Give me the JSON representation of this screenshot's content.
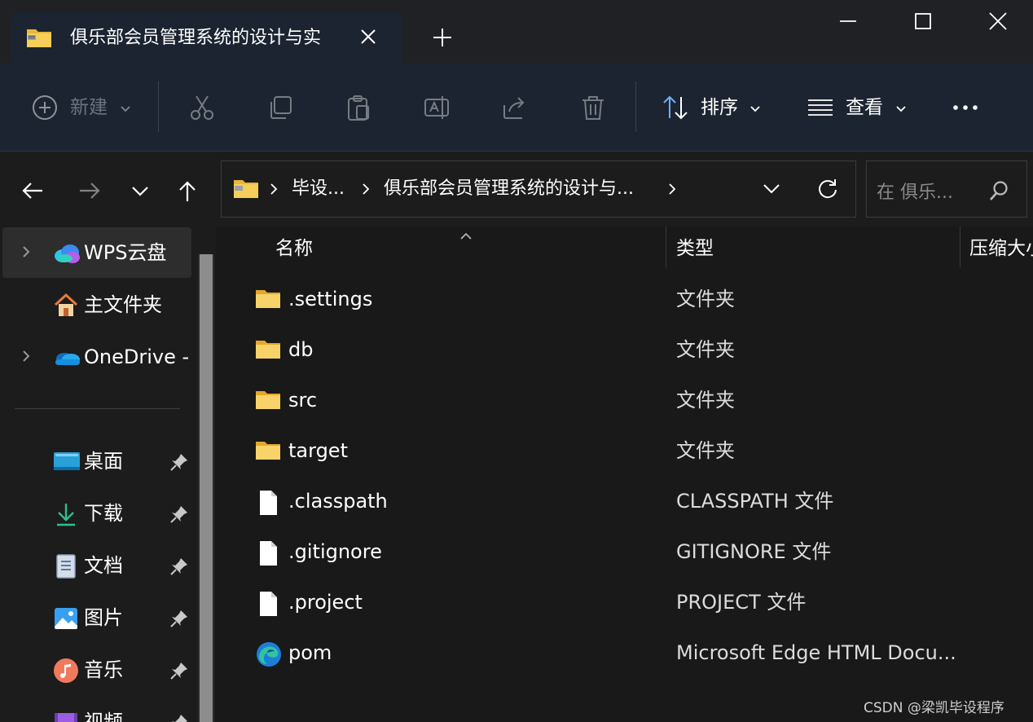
{
  "tab": {
    "title": "俱乐部会员管理系统的设计与实",
    "icon": "zip-folder-icon"
  },
  "window": {
    "minimize": "minimize-icon",
    "maximize": "maximize-icon",
    "close": "close-icon"
  },
  "command_bar": {
    "new_label": "新建",
    "sort_label": "排序",
    "view_label": "查看",
    "more": "more-icon"
  },
  "address": {
    "crumbs": [
      "毕设...",
      "俱乐部会员管理系统的设计与..."
    ]
  },
  "search": {
    "placeholder": "在 俱乐..."
  },
  "sidebar": {
    "items": [
      {
        "label": "WPS云盘",
        "icon": "wps-cloud-icon"
      },
      {
        "label": "主文件夹",
        "icon": "home-icon"
      },
      {
        "label": "OneDrive -",
        "icon": "onedrive-icon"
      },
      {
        "label": "桌面",
        "icon": "desktop-icon"
      },
      {
        "label": "下载",
        "icon": "download-icon"
      },
      {
        "label": "文档",
        "icon": "documents-icon"
      },
      {
        "label": "图片",
        "icon": "pictures-icon"
      },
      {
        "label": "音乐",
        "icon": "music-icon"
      },
      {
        "label": "视频",
        "icon": "videos-icon"
      }
    ]
  },
  "columns": {
    "name": "名称",
    "type": "类型",
    "size": "压缩大小"
  },
  "files": [
    {
      "name": ".settings",
      "type": "文件夹",
      "icon": "folder-icon"
    },
    {
      "name": "db",
      "type": "文件夹",
      "icon": "folder-icon"
    },
    {
      "name": "src",
      "type": "文件夹",
      "icon": "folder-icon"
    },
    {
      "name": "target",
      "type": "文件夹",
      "icon": "folder-icon"
    },
    {
      "name": ".classpath",
      "type": "CLASSPATH 文件",
      "icon": "file-icon"
    },
    {
      "name": ".gitignore",
      "type": "GITIGNORE 文件",
      "icon": "file-icon"
    },
    {
      "name": ".project",
      "type": "PROJECT 文件",
      "icon": "file-icon"
    },
    {
      "name": "pom",
      "type": "Microsoft Edge HTML Docu...",
      "icon": "edge-icon"
    }
  ],
  "watermark": "CSDN @梁凯毕设程序"
}
